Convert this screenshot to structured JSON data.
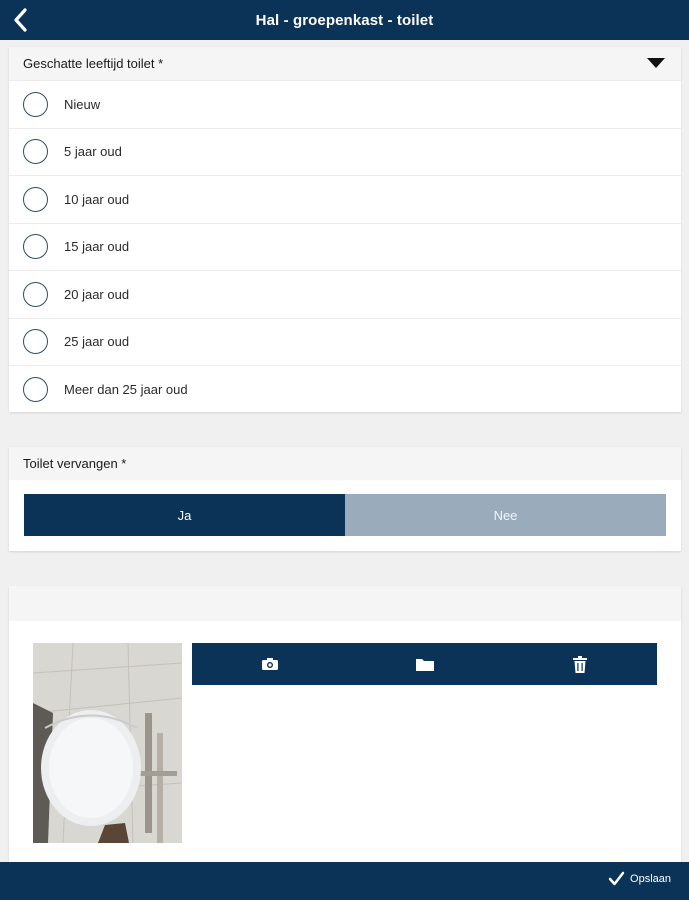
{
  "header": {
    "title": "Hal - groepenkast - toilet",
    "back_icon": "chevron-left-icon"
  },
  "age_section": {
    "title": "Geschatte leeftijd toilet *",
    "options": [
      "Nieuw",
      "5 jaar oud",
      "10 jaar oud",
      "15 jaar oud",
      "20 jaar oud",
      "25 jaar oud",
      "Meer dan 25 jaar oud"
    ]
  },
  "replace_section": {
    "title": "Toilet vervangen *",
    "yes_label": "Ja",
    "no_label": "Nee",
    "selected": "Ja"
  },
  "photo_section": {
    "title": "",
    "tools": [
      "camera-icon",
      "folder-icon",
      "trash-icon"
    ]
  },
  "footer": {
    "save_label": "Opslaan",
    "save_icon": "checkmark-icon"
  },
  "colors": {
    "primary": "#0b3358",
    "toggle_off": "#9aabbc",
    "page_bg": "#f0f0f0"
  }
}
